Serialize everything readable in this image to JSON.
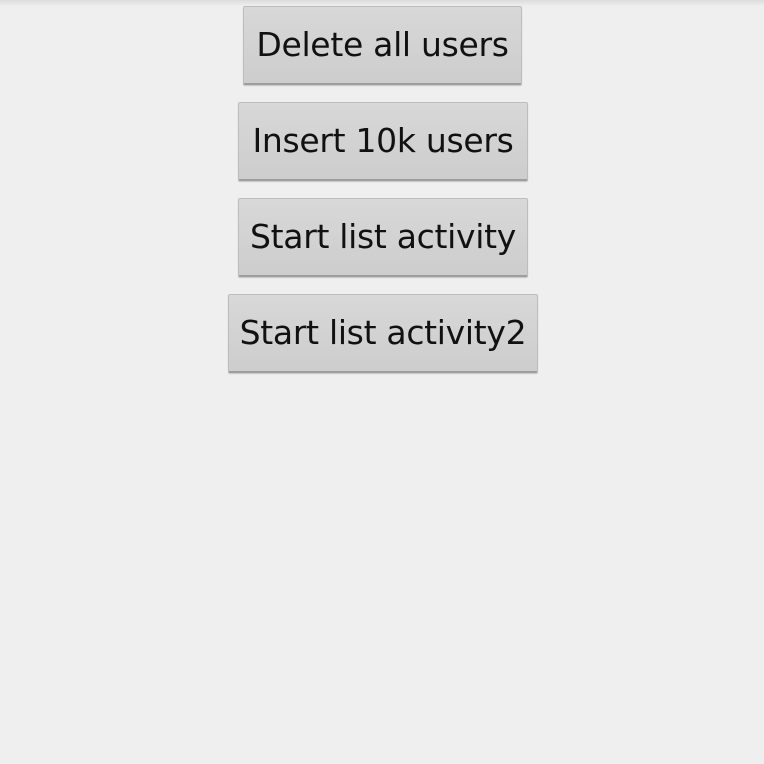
{
  "buttons": {
    "delete_all_users": "Delete all users",
    "insert_10k_users": "Insert 10k users",
    "start_list_activity": "Start list activity",
    "start_list_activity2": "Start list activity2"
  },
  "colors": {
    "background": "#efefef",
    "button_face": "#d3d3d3",
    "button_text": "#111111"
  }
}
